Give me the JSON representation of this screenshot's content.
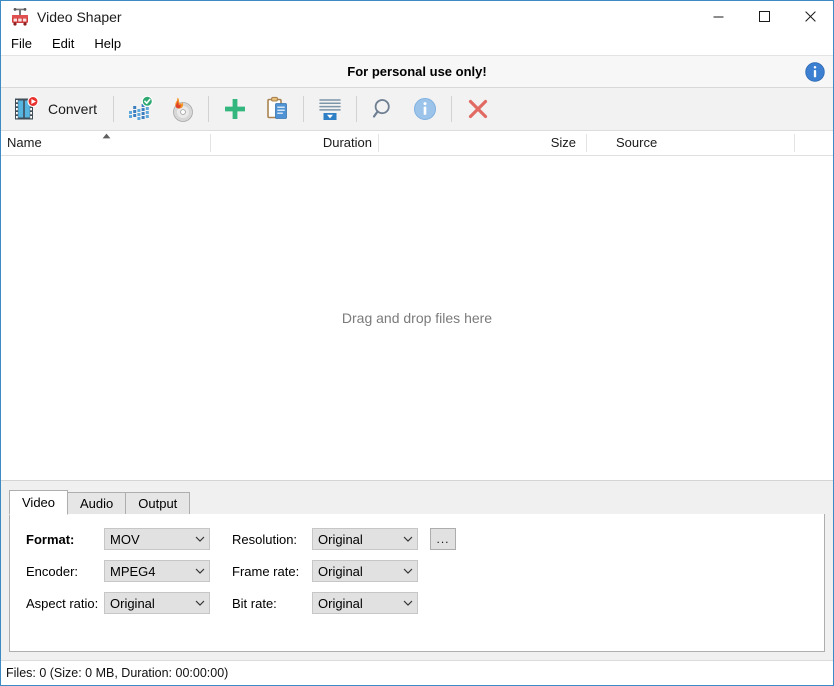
{
  "window": {
    "title": "Video Shaper",
    "app_icon": "video-camera-icon",
    "controls": {
      "minimize": "minimize-icon",
      "maximize": "maximize-icon",
      "close": "close-icon"
    }
  },
  "menu": {
    "items": [
      {
        "label": "File"
      },
      {
        "label": "Edit"
      },
      {
        "label": "Help"
      }
    ]
  },
  "banner": {
    "text": "For personal use only!",
    "info_icon": "info-circle-icon"
  },
  "toolbar": {
    "convert_label": "Convert",
    "buttons": [
      {
        "name": "convert-button",
        "icon": "film-strip-record-icon",
        "label": "Convert"
      },
      {
        "name": "audio-extract-button",
        "icon": "equalizer-bars-icon"
      },
      {
        "name": "burn-disc-button",
        "icon": "burn-disc-flame-icon"
      },
      {
        "name": "add-files-button",
        "icon": "plus-icon"
      },
      {
        "name": "paste-button",
        "icon": "clipboard-document-icon"
      },
      {
        "name": "load-list-button",
        "icon": "list-download-icon"
      },
      {
        "name": "preview-button",
        "icon": "magnifier-icon"
      },
      {
        "name": "info-button",
        "icon": "info-circle-icon"
      },
      {
        "name": "remove-button",
        "icon": "close-x-icon"
      }
    ]
  },
  "file_list": {
    "columns": [
      {
        "label": "Name",
        "sorted": "ascending"
      },
      {
        "label": "Duration"
      },
      {
        "label": "Size"
      },
      {
        "label": "Source"
      }
    ],
    "empty_text": "Drag and drop files here",
    "rows": []
  },
  "settings": {
    "tabs": [
      {
        "label": "Video",
        "active": true
      },
      {
        "label": "Audio",
        "active": false
      },
      {
        "label": "Output",
        "active": false
      }
    ],
    "video": {
      "format": {
        "label": "Format:",
        "value": "MOV"
      },
      "encoder": {
        "label": "Encoder:",
        "value": "MPEG4"
      },
      "aspect_ratio": {
        "label": "Aspect ratio:",
        "value": "Original"
      },
      "resolution": {
        "label": "Resolution:",
        "value": "Original",
        "more_button": "..."
      },
      "frame_rate": {
        "label": "Frame rate:",
        "value": "Original"
      },
      "bit_rate": {
        "label": "Bit rate:",
        "value": "Original"
      }
    }
  },
  "statusbar": {
    "text": "Files: 0 (Size: 0 MB, Duration: 00:00:00)"
  },
  "colors": {
    "window_border": "#3d8bc4",
    "banner_bg": "#f7f7f7",
    "toolbar_bg": "#f2f2f2",
    "panel_bg": "#f0f0f0",
    "accent_blue": "#4a90d9",
    "green": "#3dba80",
    "red": "#e8534c"
  }
}
